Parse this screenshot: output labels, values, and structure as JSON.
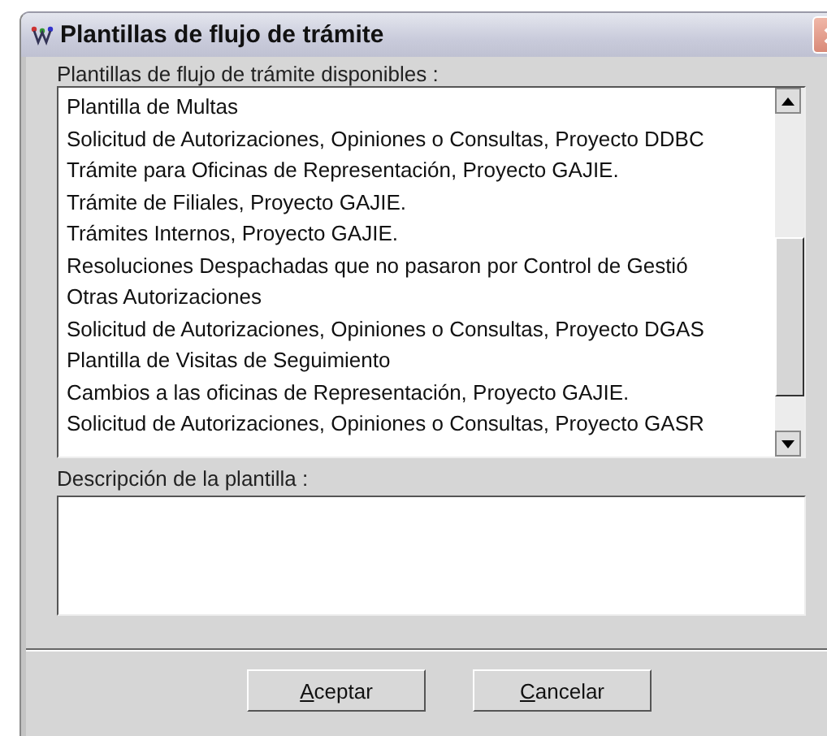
{
  "window": {
    "title": "Plantillas de flujo de trámite"
  },
  "templates": {
    "label": "Plantillas de flujo de trámite disponibles :",
    "items": [
      {
        "text": "Plantilla de Multas",
        "selected": false
      },
      {
        "text": "Solicitud de Autorizaciones, Opiniones o Consultas, Proyecto DDBC",
        "selected": false
      },
      {
        "text": "Trámite para Oficinas de Representación, Proyecto GAJIE.",
        "selected": false
      },
      {
        "text": "Trámite de Filiales, Proyecto GAJIE.",
        "selected": false
      },
      {
        "text": "Trámites Internos, Proyecto GAJIE.",
        "selected": false
      },
      {
        "text": "Resoluciones Despachadas que no pasaron por Control de Gestió",
        "selected": false
      },
      {
        "text": "Otras Autorizaciones",
        "selected": false
      },
      {
        "text": "Solicitud de Autorizaciones, Opiniones o Consultas, Proyecto DGAS",
        "selected": false
      },
      {
        "text": "Plantilla de Visitas de Seguimiento",
        "selected": false
      },
      {
        "text": "Cambios a las oficinas de Representación, Proyecto GAJIE.",
        "selected": false
      },
      {
        "text": "Solicitud de Autorizaciones, Opiniones o Consultas, Proyecto GASR",
        "selected": false
      }
    ]
  },
  "description": {
    "label": "Descripción de la plantilla :"
  },
  "buttons": [
    {
      "label": "Aceptar"
    },
    {
      "label": "Cancelar"
    }
  ]
}
